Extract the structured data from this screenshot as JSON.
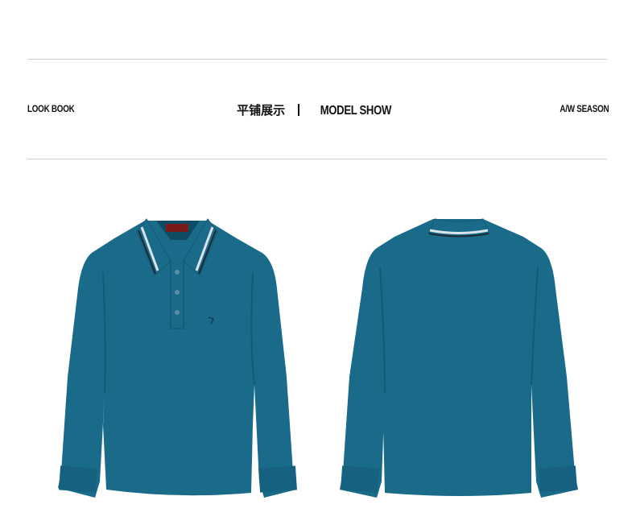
{
  "header": {
    "left_label": "LOOK BOOK",
    "title_cn": "平铺展示",
    "title_en": "MODEL SHOW",
    "right_label": "A/W SEASON"
  },
  "products": [
    {
      "view": "front",
      "color": "#1a6b8a"
    },
    {
      "view": "back",
      "color": "#1a6b8a"
    }
  ],
  "colors": {
    "shirt": "#1a6b8a",
    "shirt_shadow": "#145a75",
    "collar_stripe_light": "#d9e4ea",
    "collar_stripe_dark": "#1f2a36",
    "rule": "#cfcfcf"
  }
}
